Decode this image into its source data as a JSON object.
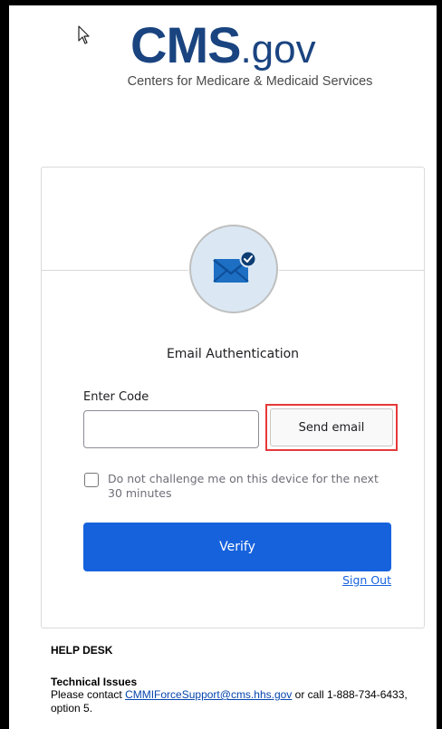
{
  "header": {
    "logo_cms": "CMS",
    "logo_gov": ".gov",
    "tagline": "Centers for Medicare & Medicaid Services"
  },
  "auth": {
    "icon": "email-icon",
    "title": "Email Authentication",
    "code_label": "Enter Code",
    "code_value": "",
    "send_email_label": "Send email",
    "remember_label": "Do not challenge me on this device for the next 30 minutes",
    "remember_checked": false,
    "verify_label": "Verify",
    "sign_out_label": "Sign Out"
  },
  "help": {
    "title": "HELP DESK",
    "tech_title": "Technical Issues",
    "tech_prefix": "Please contact ",
    "tech_email": "CMMIForceSupport@cms.hhs.gov",
    "tech_suffix": " or call 1-888-734-6433, option 5."
  },
  "colors": {
    "brand": "#1a4480",
    "primary_button": "#1662dd",
    "highlight": "#e5393b"
  }
}
